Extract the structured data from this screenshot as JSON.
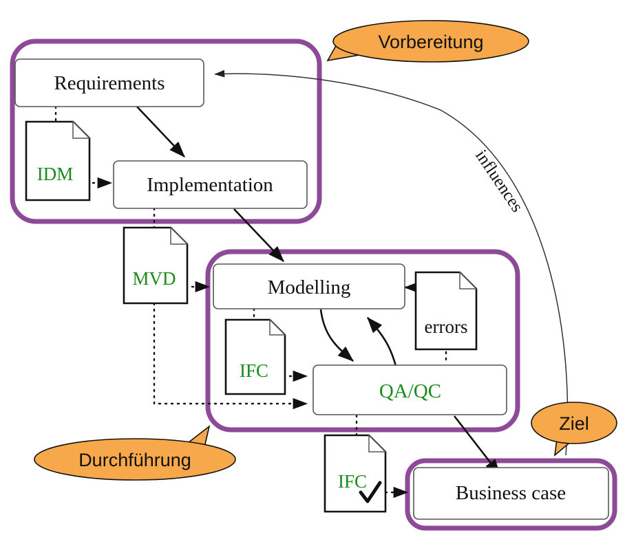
{
  "diagram": {
    "title": "BIM process diagram",
    "colors": {
      "group_purple": "#8d4a96",
      "callout_orange": "#f7a84b",
      "artifact_green": "#1a8c19",
      "node_text": "#111111"
    },
    "groups": [
      {
        "id": "vorbereitung",
        "label": "Vorbereitung"
      },
      {
        "id": "durchfuehrung",
        "label": "Durchführung"
      },
      {
        "id": "ziel",
        "label": "Ziel"
      }
    ],
    "callouts": [
      {
        "id": "callout-vorbereitung",
        "label": "Vorbereitung"
      },
      {
        "id": "callout-durchfuehrung",
        "label": "Durchführung"
      },
      {
        "id": "callout-ziel",
        "label": "Ziel"
      }
    ],
    "nodes": [
      {
        "id": "requirements",
        "label": "Requirements",
        "green": false
      },
      {
        "id": "implementation",
        "label": "Implementation",
        "green": false
      },
      {
        "id": "modelling",
        "label": "Modelling",
        "green": false
      },
      {
        "id": "qaqc",
        "label": "QA/QC",
        "green": true
      },
      {
        "id": "business-case",
        "label": "Business case",
        "green": false
      }
    ],
    "documents": [
      {
        "id": "idm",
        "label": "IDM",
        "green": true,
        "check": false
      },
      {
        "id": "mvd",
        "label": "MVD",
        "green": true,
        "check": false
      },
      {
        "id": "ifc-modelling",
        "label": "IFC",
        "green": true,
        "check": false
      },
      {
        "id": "errors",
        "label": "errors",
        "green": false,
        "check": false
      },
      {
        "id": "ifc-verified",
        "label": "IFC",
        "green": true,
        "check": true
      }
    ],
    "edges": [
      {
        "id": "requirements-to-implementation",
        "style": "solid",
        "label": ""
      },
      {
        "id": "idm-to-implementation",
        "style": "dotted",
        "label": ""
      },
      {
        "id": "requirements-to-idm",
        "style": "dotted",
        "label": ""
      },
      {
        "id": "implementation-to-mvd",
        "style": "dotted",
        "label": ""
      },
      {
        "id": "implementation-to-modelling",
        "style": "solid",
        "label": ""
      },
      {
        "id": "mvd-to-modelling",
        "style": "dotted",
        "label": ""
      },
      {
        "id": "mvd-to-qaqc",
        "style": "dotted",
        "label": ""
      },
      {
        "id": "modelling-to-ifc",
        "style": "dotted",
        "label": ""
      },
      {
        "id": "ifc-to-qaqc",
        "style": "dotted",
        "label": ""
      },
      {
        "id": "modelling-to-qaqc",
        "style": "solid",
        "label": ""
      },
      {
        "id": "qaqc-to-modelling",
        "style": "solid",
        "label": ""
      },
      {
        "id": "errors-to-modelling",
        "style": "solid",
        "label": ""
      },
      {
        "id": "qaqc-to-errors",
        "style": "dotted",
        "label": ""
      },
      {
        "id": "qaqc-to-ifc-verified",
        "style": "dotted",
        "label": ""
      },
      {
        "id": "ifc-verified-to-business-case",
        "style": "dotted",
        "label": ""
      },
      {
        "id": "qaqc-to-business-case",
        "style": "solid",
        "label": ""
      },
      {
        "id": "business-case-to-requirements",
        "style": "thin",
        "label": "influences"
      }
    ],
    "edge_labels": {
      "influences": "influences"
    }
  }
}
